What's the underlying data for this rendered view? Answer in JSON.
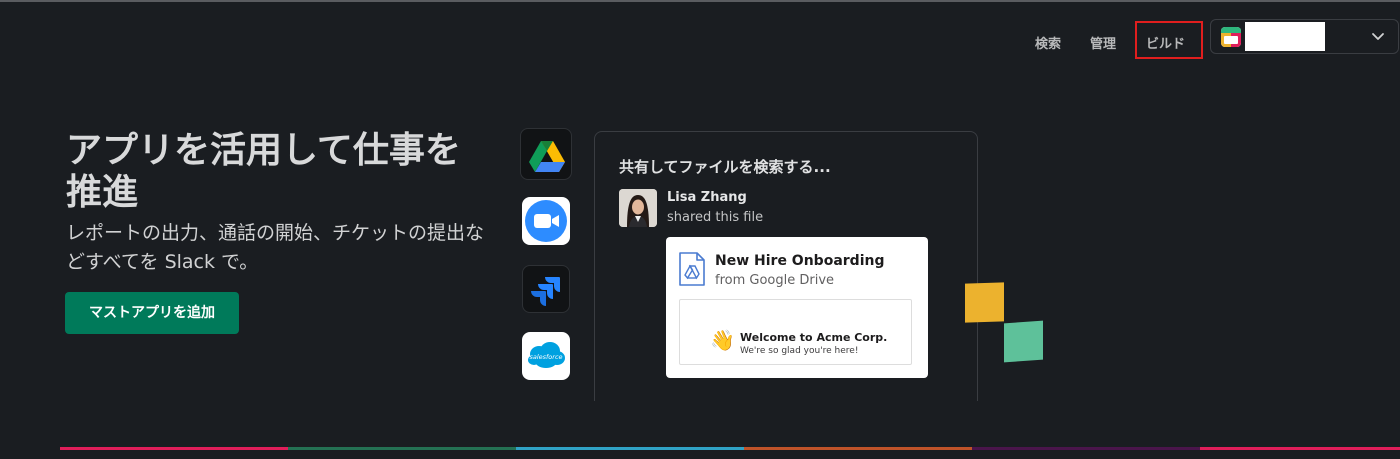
{
  "header": {
    "nav": [
      {
        "id": "search",
        "label": "検索"
      },
      {
        "id": "admin",
        "label": "管理"
      },
      {
        "id": "build",
        "label": "ビルド"
      }
    ],
    "workspace": {
      "icon": "workspace-logo-icon",
      "chevron": "chevron-down-icon"
    }
  },
  "hero": {
    "title": "アプリを活用して仕事を推進",
    "subtitle": "レポートの出力、通話の開始、チケットの提出などすべてを Slack で。",
    "cta_label": "マストアプリを追加"
  },
  "apps": [
    {
      "name": "Google Drive",
      "icon": "google-drive-icon"
    },
    {
      "name": "Zoom",
      "icon": "zoom-icon"
    },
    {
      "name": "Jira",
      "icon": "jira-icon"
    },
    {
      "name": "Salesforce",
      "icon": "salesforce-icon",
      "label": "salesforce"
    }
  ],
  "search_card": {
    "title": "共有してファイルを検索する...",
    "user_name": "Lisa Zhang",
    "user_action": "shared this file",
    "file": {
      "title": "New Hire Onboarding",
      "source": "from Google Drive",
      "preview_emoji": "👋",
      "preview_title": "Welcome to Acme Corp.",
      "preview_subtitle": "We're so glad you're here!"
    }
  },
  "colors": {
    "background": "#1a1d21",
    "cta": "#007a5a",
    "highlight_box": "#e01e1e",
    "deco_yellow": "#ecb22e",
    "deco_green": "#5ec19a",
    "stripe": [
      "#e01e5a",
      "#2eb67d",
      "#36c5f0",
      "#ecb22e",
      "#e01e5a",
      "#e01e5a"
    ]
  }
}
